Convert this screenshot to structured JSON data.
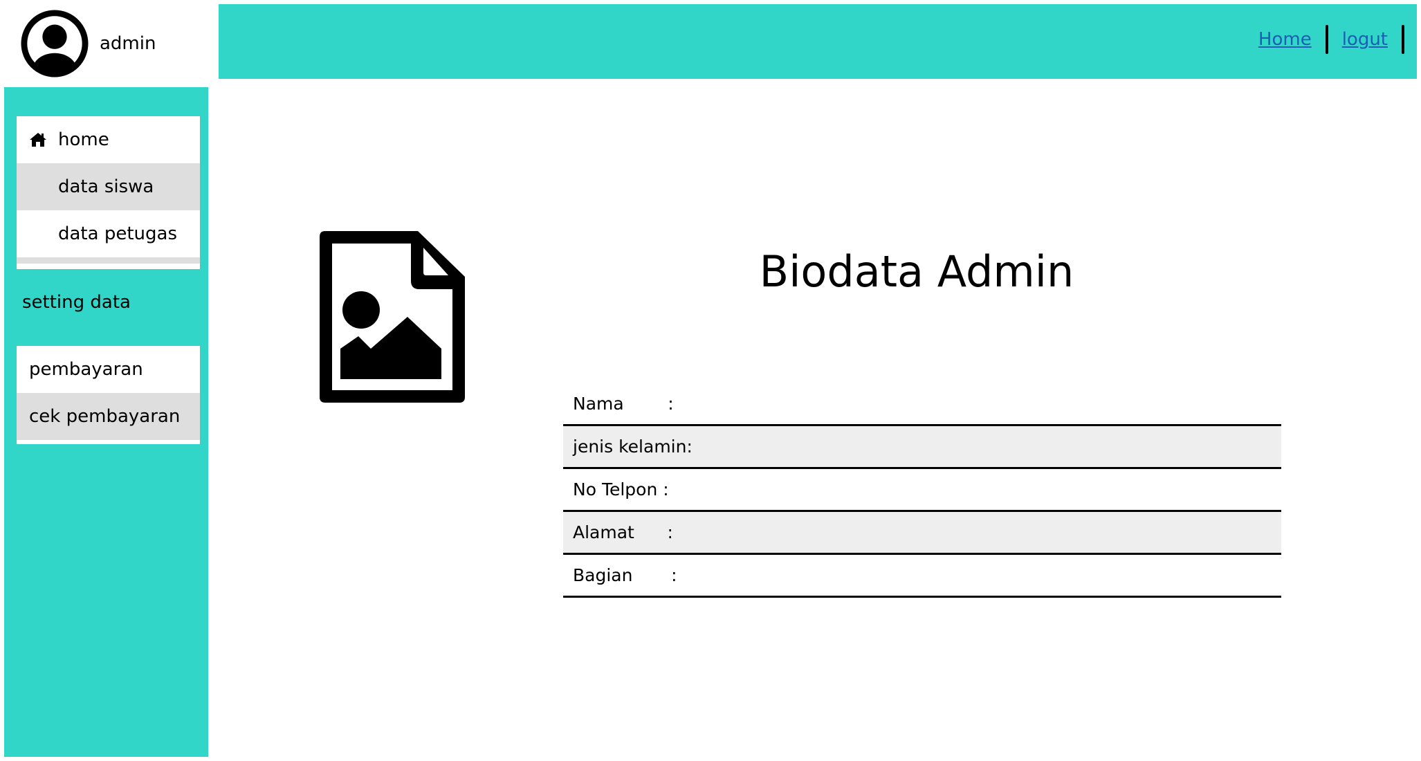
{
  "user": {
    "name": "admin",
    "icon": "user-avatar-icon"
  },
  "topbar": {
    "color": "#32d6c9",
    "links": [
      {
        "label": "Home"
      },
      {
        "label": "logut"
      }
    ]
  },
  "sidebar": {
    "color": "#32d6c9",
    "group1": [
      {
        "label": "home",
        "icon": "home-icon"
      },
      {
        "label": "data siswa"
      },
      {
        "label": "data petugas"
      }
    ],
    "section_label": "setting data",
    "group2": [
      {
        "label": "pembayaran"
      },
      {
        "label": "cek pembayaran"
      }
    ]
  },
  "main": {
    "image_icon": "image-file-icon",
    "title": "Biodata Admin",
    "fields": [
      {
        "label": "Nama        :"
      },
      {
        "label": "jenis kelamin:"
      },
      {
        "label": "No Telpon :"
      },
      {
        "label": "Alamat      :"
      },
      {
        "label": "Bagian       :"
      }
    ]
  }
}
